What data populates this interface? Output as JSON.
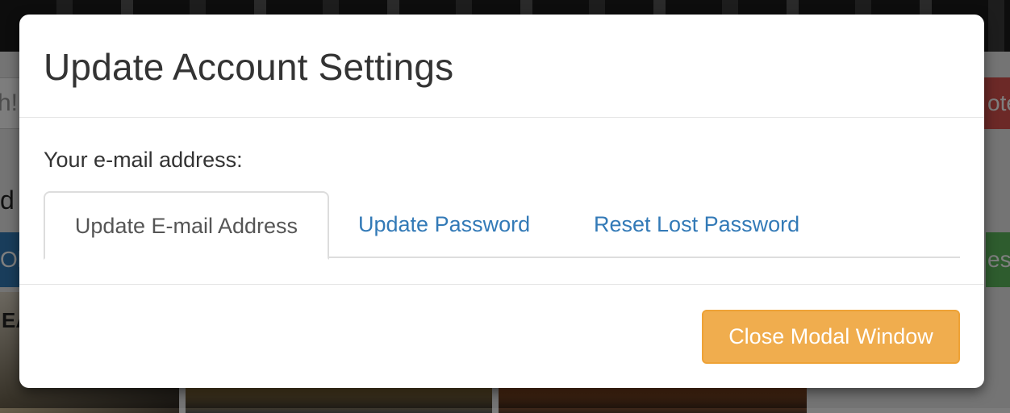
{
  "background": {
    "search_partial": "h!",
    "red_button_partial": "ote",
    "heading_partial": "d",
    "blue_button_partial": "Ol",
    "green_button_partial": "est",
    "poster_text_partial": "EA"
  },
  "modal": {
    "title": "Update Account Settings",
    "email_label": "Your e-mail address:",
    "tabs": [
      {
        "label": "Update E-mail Address",
        "active": true
      },
      {
        "label": "Update Password",
        "active": false
      },
      {
        "label": "Reset Lost Password",
        "active": false
      }
    ],
    "close_button_label": "Close Modal Window"
  },
  "colors": {
    "primary_link": "#337ab7",
    "warning_button": "#f0ad4e",
    "danger": "#d9534f",
    "success": "#5cb85c"
  }
}
